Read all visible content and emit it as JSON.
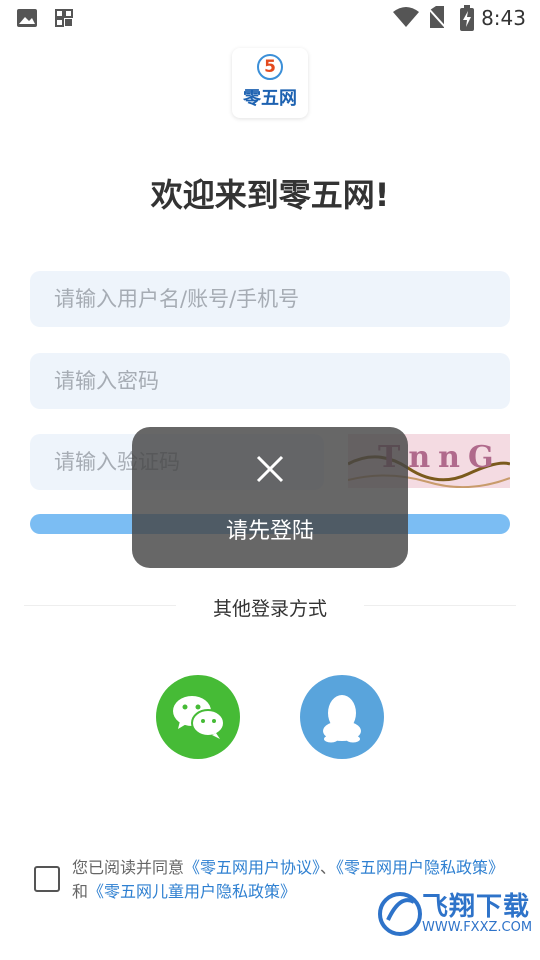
{
  "status_bar": {
    "time": "8:43",
    "icons": [
      "image-icon",
      "grid-icon",
      "wifi-icon",
      "no-sim-icon",
      "battery-charging-icon"
    ]
  },
  "app": {
    "logo_number": "5",
    "logo_text": "零五网",
    "welcome": "欢迎来到零五网!"
  },
  "form": {
    "username_placeholder": "请输入用户名/账号/手机号",
    "password_placeholder": "请输入密码",
    "captcha_placeholder": "请输入验证码",
    "captcha_text": "TnnG"
  },
  "other_login": {
    "label": "其他登录方式",
    "icons": [
      "wechat-icon",
      "qq-icon"
    ]
  },
  "agreement": {
    "prefix": "您已阅读并同意",
    "link1": "《零五网用户协议》",
    "sep1": "、",
    "link2": "《零五网用户隐私政策》",
    "sep2": "和",
    "link3": "《零五网儿童用户隐私政策》"
  },
  "toast": {
    "message": "请先登陆"
  },
  "watermark": {
    "brand": "飞翔下载",
    "site": "WWW.FXXZ.COM"
  },
  "colors": {
    "accent": "#7bbdf3",
    "wechat": "#46bb36",
    "qq": "#59a4dc",
    "link": "#2f80d1"
  }
}
